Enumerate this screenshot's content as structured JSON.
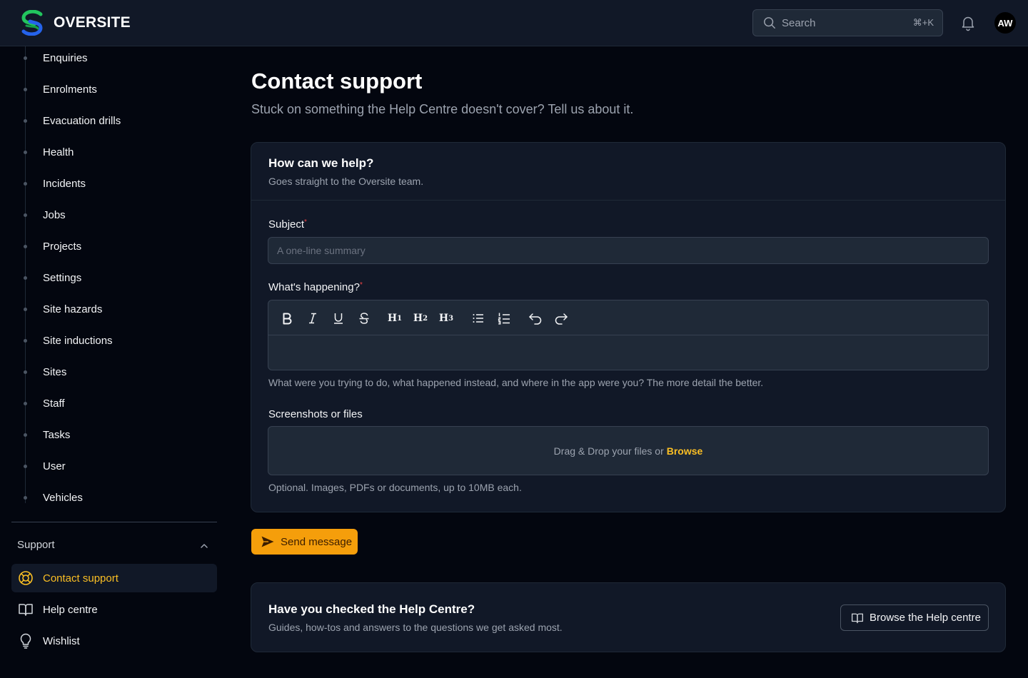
{
  "brand": {
    "name": "OVERSITE",
    "color_green": "#22c55e",
    "color_blue": "#2563eb"
  },
  "header": {
    "search_placeholder": "Search",
    "search_shortcut": "⌘+K",
    "notifications_icon": "bell-icon",
    "avatar_initials": "AW"
  },
  "sidebar": {
    "items": [
      {
        "label": "Enquiries"
      },
      {
        "label": "Enrolments"
      },
      {
        "label": "Evacuation drills"
      },
      {
        "label": "Health"
      },
      {
        "label": "Incidents"
      },
      {
        "label": "Jobs"
      },
      {
        "label": "Projects"
      },
      {
        "label": "Settings"
      },
      {
        "label": "Site hazards"
      },
      {
        "label": "Site inductions"
      },
      {
        "label": "Sites"
      },
      {
        "label": "Staff"
      },
      {
        "label": "Tasks"
      },
      {
        "label": "User"
      },
      {
        "label": "Vehicles"
      }
    ],
    "support": {
      "heading": "Support",
      "links": [
        {
          "label": "Contact support",
          "icon": "lifebuoy-icon",
          "active": true
        },
        {
          "label": "Help centre",
          "icon": "book-icon",
          "active": false
        },
        {
          "label": "Wishlist",
          "icon": "lightbulb-icon",
          "active": false
        }
      ]
    }
  },
  "main": {
    "title": "Contact support",
    "subtitle": "Stuck on something the Help Centre doesn't cover? Tell us about it.",
    "form": {
      "title": "How can we help?",
      "description": "Goes straight to the Oversite team.",
      "subject_label": "Subject",
      "required_mark": "*",
      "subject_placeholder": "A one-line summary",
      "subject_value": "",
      "details_label": "What's happening?",
      "details_help": "What were you trying to do, what happened instead, and where in the app were you? The more detail the better.",
      "toolbar": {
        "h1": "H",
        "h1_num": "1",
        "h2": "H",
        "h2_num": "2",
        "h3": "H",
        "h3_num": "3"
      },
      "files_label": "Screenshots or files",
      "dropzone_text": "Drag & Drop your files or",
      "browse_label": "Browse",
      "files_help": "Optional. Images, PDFs or documents, up to 10MB each."
    },
    "send_label": "Send message",
    "help_card": {
      "title": "Have you checked the Help Centre?",
      "description": "Guides, how-tos and answers to the questions we get asked most.",
      "button_label": "Browse the Help centre"
    }
  },
  "colors": {
    "accent": "#f59e0b",
    "accent_text": "#fbbf24",
    "background": "#03060f",
    "surface": "#111827"
  }
}
